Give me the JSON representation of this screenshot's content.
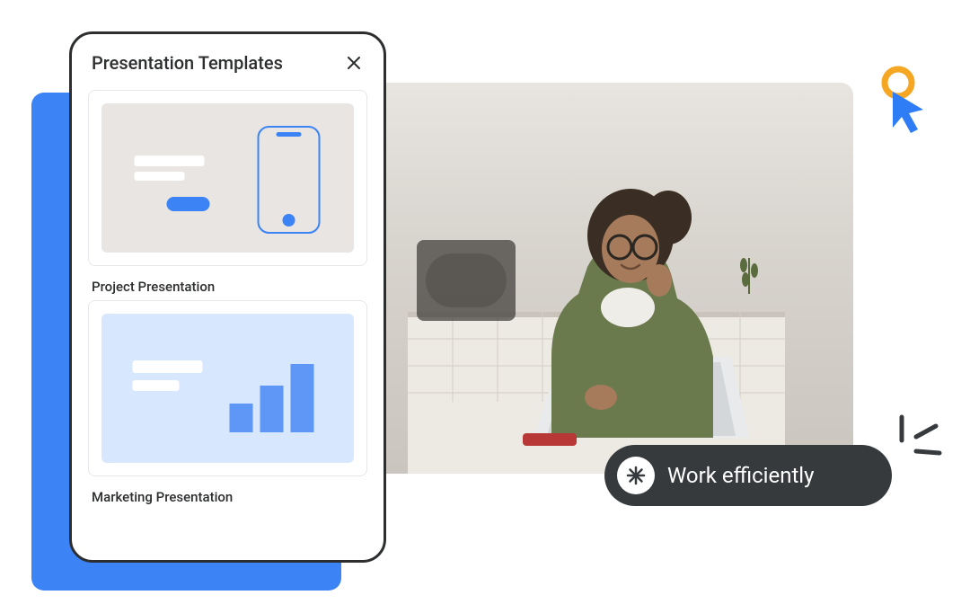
{
  "panel": {
    "title": "Presentation Templates",
    "close_icon": "close",
    "templates": [
      {
        "label": "Project Presentation",
        "thumb_kind": "project"
      },
      {
        "label": "Marketing Presentation",
        "thumb_kind": "marketing"
      }
    ]
  },
  "pill": {
    "icon": "asterisk",
    "text": "Work efficiently"
  },
  "decorations": {
    "cursor": "cursor-pointer",
    "accent": "accent-lines"
  }
}
